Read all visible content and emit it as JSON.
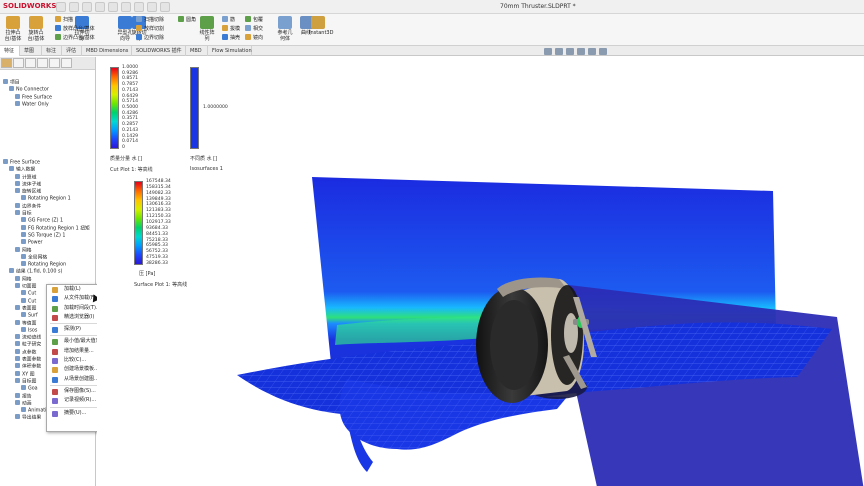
{
  "app": {
    "logo_text": "SOLIDWORKS",
    "doc_title": "70mm Thruster.SLDPRT *"
  },
  "quick_access": [
    "home-icon",
    "new-file-icon",
    "open-file-icon",
    "save-icon",
    "print-icon",
    "undo-icon",
    "select-icon",
    "rebuild-icon",
    "options-icon"
  ],
  "ribbon": {
    "big_buttons": [
      {
        "label": "拉伸凸\n台/基体",
        "icon": "boss-extrude-icon"
      },
      {
        "label": "旋转凸\n台/基体",
        "icon": "revolve-boss-icon"
      },
      {
        "label": "拉伸切\n除",
        "icon": "cut-extrude-icon"
      },
      {
        "label": "异型孔\n向导",
        "icon": "hole-wizard-icon"
      },
      {
        "label": "旋转切\n除",
        "icon": "revolve-cut-icon"
      },
      {
        "label": "线性阵\n列",
        "icon": "linear-pattern-icon"
      },
      {
        "label": "参考几\n何体",
        "icon": "reference-geometry-icon"
      },
      {
        "label": "曲线",
        "icon": "curves-icon"
      },
      {
        "label": "Instant3D",
        "icon": "instant3d-icon"
      }
    ],
    "small_buttons": [
      "扫描",
      "放样凸台/基体",
      "边界凸台/基体",
      "扫描切除",
      "放样切割",
      "边界切除",
      "圆角",
      "筋",
      "拔模",
      "抽壳",
      "包覆",
      "相交",
      "镜向"
    ]
  },
  "tabs": [
    "特征",
    "草图",
    "标注",
    "评估",
    "MBD Dimensions",
    "SOLIDWORKS 插件",
    "MBD",
    "Flow Simulation"
  ],
  "tree_top": [
    {
      "label": "项目",
      "indent": 0
    },
    {
      "label": "No Connector",
      "indent": 1
    },
    {
      "label": "Free Surface",
      "indent": 2
    },
    {
      "label": "Water Only",
      "indent": 2
    }
  ],
  "tree_main": [
    {
      "label": "Free Surface",
      "indent": 0
    },
    {
      "label": "输入数据",
      "indent": 1
    },
    {
      "label": "计算域",
      "indent": 2
    },
    {
      "label": "流体子域",
      "indent": 2
    },
    {
      "label": "旋转区域",
      "indent": 2
    },
    {
      "label": "Rotating Region 1",
      "indent": 3
    },
    {
      "label": "边界条件",
      "indent": 2
    },
    {
      "label": "目标",
      "indent": 2
    },
    {
      "label": "GG Force (Z) 1",
      "indent": 3
    },
    {
      "label": "FG Rotating Region 1 扭矩",
      "indent": 3
    },
    {
      "label": "SG Torque (Z) 1",
      "indent": 3
    },
    {
      "label": "Power",
      "indent": 3
    },
    {
      "label": "网格",
      "indent": 2
    },
    {
      "label": "全局网格",
      "indent": 3
    },
    {
      "label": "Rotating Region",
      "indent": 3
    },
    {
      "label": "结果 (1.fld, 0.100 s)",
      "indent": 1
    },
    {
      "label": "网格",
      "indent": 2
    },
    {
      "label": "切面图",
      "indent": 2
    },
    {
      "label": "Cut",
      "indent": 3
    },
    {
      "label": "Cut",
      "indent": 3
    },
    {
      "label": "表面图",
      "indent": 2
    },
    {
      "label": "Surf",
      "indent": 3
    },
    {
      "label": "等值面",
      "indent": 2
    },
    {
      "label": "Isos",
      "indent": 3
    },
    {
      "label": "流动迹线",
      "indent": 2
    },
    {
      "label": "粒子研究",
      "indent": 2
    },
    {
      "label": "点参数",
      "indent": 2
    },
    {
      "label": "表面参数",
      "indent": 2
    },
    {
      "label": "体积参数",
      "indent": 2
    },
    {
      "label": "XY 图",
      "indent": 2
    },
    {
      "label": "目标图",
      "indent": 2
    },
    {
      "label": "Goa",
      "indent": 3
    },
    {
      "label": "报告",
      "indent": 2
    },
    {
      "label": "动画",
      "indent": 2
    },
    {
      "label": "Animation 1",
      "indent": 3
    },
    {
      "label": "导出结果",
      "indent": 2
    }
  ],
  "context_menu": {
    "groups": [
      [
        {
          "label": "加载(L)",
          "icon": "load-icon"
        },
        {
          "label": "从文件加载(F)...",
          "icon": "load-file-icon"
        },
        {
          "label": "加载时间段(T)...",
          "icon": "time-icon"
        },
        {
          "label": "精选浏览器(I)",
          "icon": "browser-icon"
        }
      ],
      [
        {
          "label": "探测(P)",
          "icon": "probe-icon"
        }
      ],
      [
        {
          "label": "最小值/最大值表(X)...",
          "icon": "minmax-table-icon"
        },
        {
          "label": "增加结果量...",
          "icon": "add-result-icon"
        },
        {
          "label": "比较(C)...",
          "icon": "compare-icon"
        },
        {
          "label": "创建场景模板...",
          "icon": "scene-template-icon"
        },
        {
          "label": "从场景创建图...",
          "icon": "create-plot-icon"
        }
      ],
      [
        {
          "label": "保存图像(S)...",
          "icon": "save-image-icon"
        },
        {
          "label": "记录视频(R)...",
          "icon": "record-video-icon"
        }
      ],
      [
        {
          "label": "摘要(U)...",
          "icon": "summary-icon"
        }
      ]
    ]
  },
  "legends": {
    "cut": {
      "ticks": [
        "1.0000",
        "0.9286",
        "0.8571",
        "0.7857",
        "0.7143",
        "0.6429",
        "0.5714",
        "0.5000",
        "0.4286",
        "0.3571",
        "0.2857",
        "0.2143",
        "0.1429",
        "0.0714",
        "0"
      ],
      "caption": "质量分量 水 []",
      "plot_name": "Cut Plot 1: 等高线"
    },
    "iso": {
      "tick": "1.0000000",
      "caption": "不同质 水 []",
      "plot_name": "Isosurfaces 1"
    },
    "surface": {
      "ticks": [
        "167548.34",
        "158315.34",
        "149082.33",
        "139849.33",
        "130616.33",
        "121383.33",
        "112150.33",
        "102917.33",
        "93684.33",
        "84451.33",
        "75218.33",
        "65985.33",
        "56752.33",
        "47519.33",
        "38286.33"
      ],
      "caption": "压 [Pa]",
      "plot_name": "Surface Plot 1: 等高线"
    }
  },
  "colors": {
    "jet": [
      "#e8001a",
      "#ff6a00",
      "#ffc400",
      "#d7ef00",
      "#6ee600",
      "#00d26b",
      "#00d9d0",
      "#009cff",
      "#1d47ff",
      "#2b18d8"
    ],
    "iso_blue": "#1a35e6",
    "water": "#1531dc",
    "plane": "#2b2db8",
    "wheel_tire": "#1c1c1c",
    "wheel_rim": "#c9bea9"
  }
}
